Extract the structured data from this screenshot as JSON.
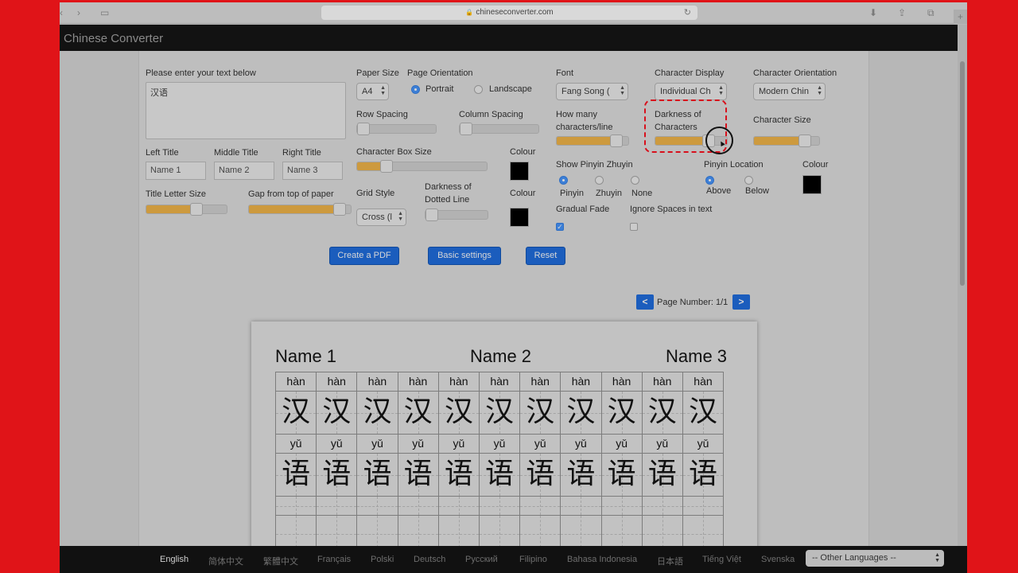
{
  "browser": {
    "url": "chineseconverter.com",
    "plus": "+"
  },
  "app": {
    "title": "Chinese Converter"
  },
  "form": {
    "text_label": "Please enter your text below",
    "text_value": "汉语",
    "paper_size_label": "Paper Size",
    "paper_size_value": "A4",
    "orientation_label": "Page Orientation",
    "portrait": "Portrait",
    "landscape": "Landscape",
    "row_spacing": "Row Spacing",
    "column_spacing": "Column Spacing",
    "left_title_label": "Left Title",
    "middle_title_label": "Middle Title",
    "right_title_label": "Right Title",
    "left_title_value": "Name 1",
    "middle_title_value": "Name 2",
    "right_title_value": "Name 3",
    "char_box_size": "Character Box Size",
    "colour": "Colour",
    "title_letter_size": "Title Letter Size",
    "gap_top": "Gap from top of paper",
    "grid_style_label": "Grid Style",
    "grid_style_value": "Cross (l",
    "darkness_dotted_1": "Darkness of",
    "darkness_dotted_2": "Dotted Line",
    "font_label": "Font",
    "font_value": "Fang Song (",
    "char_display_label": "Character Display",
    "char_display_value": "Individual Ch",
    "char_orient_label": "Character Orientation",
    "char_orient_value": "Modern Chin",
    "how_many_1": "How many",
    "how_many_2": "characters/line",
    "darkness_chars_1": "Darkness of",
    "darkness_chars_2": "Characters",
    "char_size": "Character Size",
    "show_pinyin": "Show Pinyin Zhuyin",
    "pinyin": "Pinyin",
    "zhuyin": "Zhuyin",
    "none": "None",
    "pinyin_location": "Pinyin Location",
    "above": "Above",
    "below": "Below",
    "gradual_fade": "Gradual Fade",
    "ignore_spaces": "Ignore Spaces in text",
    "arrows": "▲▼",
    "check_mark": "✓"
  },
  "sliders": {
    "row_spacing": 0.0,
    "column_spacing": 0.0,
    "char_box_size": 0.2,
    "title_letter_size": 0.65,
    "gap_top": 0.95,
    "darkness_dotted": 0.0,
    "chars_per_line": 0.9,
    "darkness_chars": 0.8,
    "char_size": 0.85
  },
  "buttons": {
    "create_pdf": "Create a PDF",
    "basic_settings": "Basic settings",
    "reset": "Reset"
  },
  "pager": {
    "prev": "<",
    "next": ">",
    "label": "Page Number: 1/1"
  },
  "preview": {
    "left": "Name 1",
    "middle": "Name 2",
    "right": "Name 3",
    "rows": [
      {
        "pinyin": "hàn",
        "char": "汉"
      },
      {
        "pinyin": "yǔ",
        "char": "语"
      }
    ],
    "cols": 11
  },
  "languages": [
    "English",
    "简体中文",
    "繁體中文",
    "Français",
    "Polski",
    "Deutsch",
    "Русский",
    "Filipino",
    "Bahasa Indonesia",
    "日本語",
    "Tiếng Việt",
    "Svenska"
  ],
  "other_languages": "-- Other Languages --",
  "colors": {
    "accent": "#cd9a3e",
    "button": "#1b5dbd",
    "highlight": "#d8101c",
    "side_border": "#e01418"
  }
}
